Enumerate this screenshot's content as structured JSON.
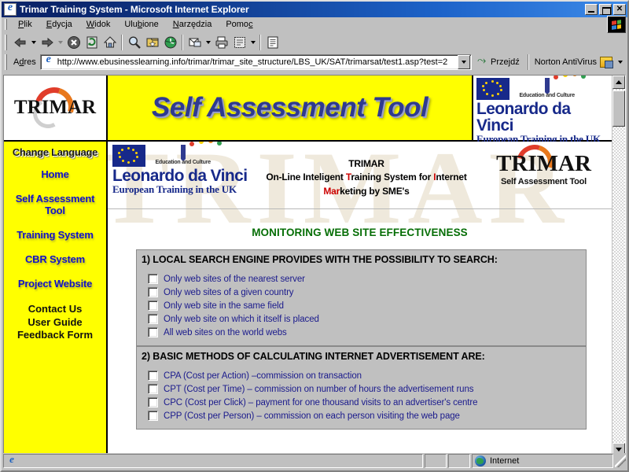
{
  "window": {
    "title": "Trimar Training System - Microsoft Internet Explorer",
    "minimize_label": "",
    "restore_label": "",
    "close_label": "✕"
  },
  "menu": {
    "items": [
      {
        "label": "Plik"
      },
      {
        "label": "Edycja"
      },
      {
        "label": "Widok"
      },
      {
        "label": "Ulubione"
      },
      {
        "label": "Narzędzia"
      },
      {
        "label": "Pomoc"
      }
    ]
  },
  "toolbar": {
    "buttons": [
      {
        "name": "back",
        "glyph": "⇦"
      },
      {
        "name": "forward",
        "glyph": "⇨"
      },
      {
        "name": "stop",
        "glyph": "✖"
      },
      {
        "name": "refresh",
        "glyph": "⟳"
      },
      {
        "name": "home",
        "glyph": "⌂"
      },
      {
        "name": "search",
        "glyph": "🔍"
      },
      {
        "name": "favorites",
        "glyph": "★"
      },
      {
        "name": "history",
        "glyph": "⟲"
      },
      {
        "name": "mail",
        "glyph": "✉"
      },
      {
        "name": "print",
        "glyph": "🖶"
      },
      {
        "name": "edit",
        "glyph": "▨"
      },
      {
        "name": "discuss",
        "glyph": "▤"
      }
    ]
  },
  "address": {
    "label": "Adres",
    "url": "http://www.ebusinesslearning.info/trimar/trimar_site_structure/LBS_UK/SAT/trimarsat/test1.asp?test=2",
    "go_label": "Przejdź",
    "norton_label": "Norton AntiVirus"
  },
  "banner": {
    "logo_word": "TRIMAR",
    "title": "Self Assessment Tool",
    "eu": {
      "education_caption": "Education and Culture",
      "leonardo_main": "Leonardo da Vinci",
      "leonardo_sub": "European Training in the UK"
    }
  },
  "sidebar": {
    "change_language": "Change Language",
    "links": [
      {
        "label": "Home"
      },
      {
        "label": "Self Assessment Tool"
      },
      {
        "label": "Training System"
      },
      {
        "label": "CBR System"
      },
      {
        "label": "Project Website"
      }
    ],
    "plain_links": [
      {
        "label": "Contact Us"
      },
      {
        "label": "User Guide"
      },
      {
        "label": "Feedback Form"
      }
    ]
  },
  "content_header": {
    "eu": {
      "education_caption": "Education and Culture",
      "leonardo_main": "Leonardo da Vinci",
      "leonardo_sub": "European Training in the UK"
    },
    "project_name": "TRIMAR",
    "tagline_line1_a": "On-Line Inteligent ",
    "tagline_line1_t": "T",
    "tagline_line1_b": "raining System for ",
    "tagline_line1_i": "I",
    "tagline_line1_c": "nternet",
    "tagline_line2_mar": "Mar",
    "tagline_line2_rest": "keting by SME's",
    "logo_word": "TRIMAR",
    "logo_sub": "Self Assessment Tool"
  },
  "main": {
    "section_title": "MONITORING WEB SITE EFFECTIVENESS",
    "questions": [
      {
        "title": "1) LOCAL SEARCH ENGINE PROVIDES WITH THE POSSIBILITY TO SEARCH:",
        "options": [
          {
            "label": "Only web sites of the nearest server",
            "checked": false
          },
          {
            "label": "Only web sites of a given country",
            "checked": false
          },
          {
            "label": "Only web site in the same field",
            "checked": false
          },
          {
            "label": "Only web site on which it itself is placed",
            "checked": false
          },
          {
            "label": "All web sites on the world webs",
            "checked": false
          }
        ]
      },
      {
        "title": "2) BASIC METHODS OF CALCULATING INTERNET ADVERTISEMENT ARE:",
        "options": [
          {
            "label": "CPA (Cost per Action) –commission on transaction",
            "checked": false
          },
          {
            "label": "CPT (Cost per Time) – commission on number of hours the advertisement runs",
            "checked": false
          },
          {
            "label": "CPC (Cost per Click) – payment for one thousand visits to an advertiser's centre",
            "checked": false
          },
          {
            "label": "CPP (Cost per Person) – commission on each person visiting the web page",
            "checked": false
          }
        ]
      }
    ],
    "watermark": "TRIMAR"
  },
  "statusbar": {
    "message": "",
    "zone": "Internet"
  },
  "colors": {
    "banner_yellow": "#ffff00",
    "title_blue": "#2f3a8f",
    "link_blue": "#1212c8",
    "section_green": "#066e06",
    "option_blue": "#1a1a8c",
    "accent_red": "#cc0000",
    "chrome_gray": "#c0c0c0"
  }
}
